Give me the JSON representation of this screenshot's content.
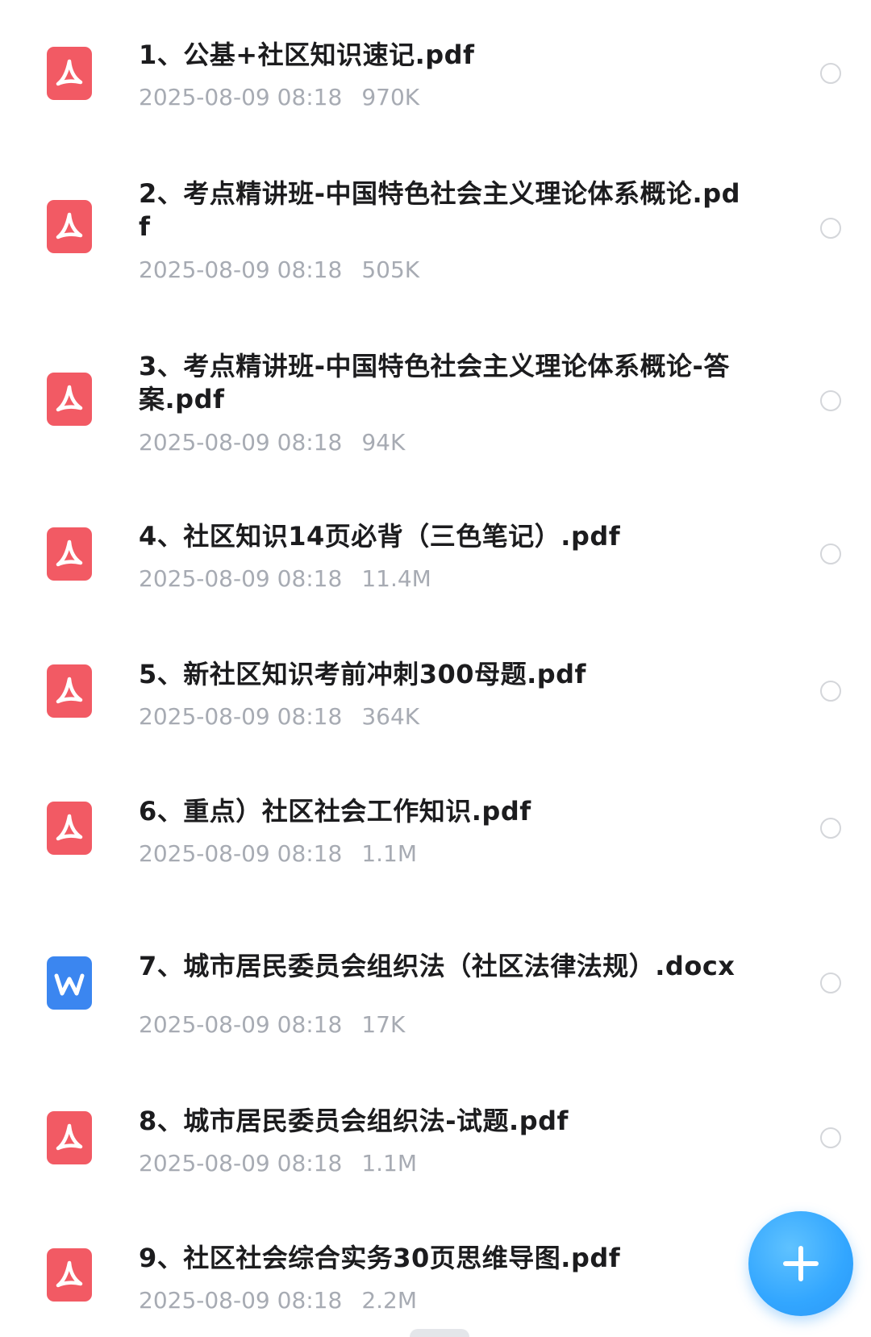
{
  "files": [
    {
      "name": "1、公基+社区知识速记.pdf",
      "date": "2025-08-09 08:18",
      "size": "970K",
      "type": "pdf",
      "icon": "pdf-icon"
    },
    {
      "name": "2、考点精讲班-中国特色社会主义理论体系概论.pdf",
      "date": "2025-08-09 08:18",
      "size": "505K",
      "type": "pdf",
      "icon": "pdf-icon"
    },
    {
      "name": "3、考点精讲班-中国特色社会主义理论体系概论-答案.pdf",
      "date": "2025-08-09 08:18",
      "size": "94K",
      "type": "pdf",
      "icon": "pdf-icon"
    },
    {
      "name": "4、社区知识14页必背（三色笔记）.pdf",
      "date": "2025-08-09 08:18",
      "size": "11.4M",
      "type": "pdf",
      "icon": "pdf-icon"
    },
    {
      "name": "5、新社区知识考前冲刺300母题.pdf",
      "date": "2025-08-09 08:18",
      "size": "364K",
      "type": "pdf",
      "icon": "pdf-icon"
    },
    {
      "name": "6、重点）社区社会工作知识.pdf",
      "date": "2025-08-09 08:18",
      "size": "1.1M",
      "type": "pdf",
      "icon": "pdf-icon"
    },
    {
      "name": "7、城市居民委员会组织法（社区法律法规）.docx",
      "date": "2025-08-09 08:18",
      "size": "17K",
      "type": "docx",
      "icon": "word-icon",
      "icon_letter": "W"
    },
    {
      "name": "8、城市居民委员会组织法-试题.pdf",
      "date": "2025-08-09 08:18",
      "size": "1.1M",
      "type": "pdf",
      "icon": "pdf-icon"
    },
    {
      "name": "9、社区社会综合实务30页思维导图.pdf",
      "date": "2025-08-09 08:18",
      "size": "2.2M",
      "type": "pdf",
      "icon": "pdf-icon"
    }
  ],
  "fab": {
    "icon": "plus-icon"
  },
  "colors": {
    "pdf_icon": "#f25a64",
    "word_icon": "#3b86f0",
    "name_text": "#1c1c1e",
    "meta_text": "#a7abb3",
    "fab": "#32a6ff"
  }
}
